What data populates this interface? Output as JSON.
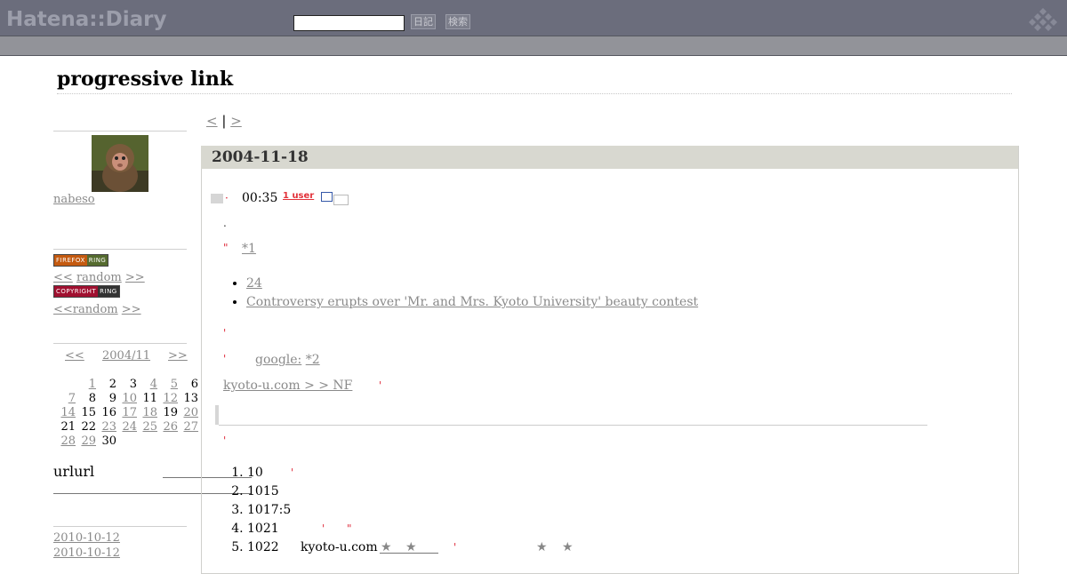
{
  "header": {
    "logo": "Hatena::Diary",
    "search_value": "",
    "diary_button": "日記",
    "search_button": "検索"
  },
  "blog": {
    "title": "progressive link"
  },
  "sidebar": {
    "profile": {
      "username": "nabeso",
      "avatar_icon": "monkey-avatar"
    },
    "rings": [
      {
        "left": "FIREFOX",
        "right": "RING",
        "left_color": "#c45a10",
        "right_color": "#556b2f",
        "nav_prev": "<<",
        "nav_random": "random",
        "nav_next": ">>"
      },
      {
        "left": "COPYRIGHT",
        "right": "RING",
        "left_color": "#a01030",
        "right_color": "#333333",
        "nav_prev": "<<",
        "nav_random": "random",
        "nav_next": ">>"
      }
    ],
    "calendar": {
      "prev": "<<",
      "month": "2004/11",
      "next": ">>",
      "weeks": [
        [
          "",
          "1",
          "2",
          "3",
          "4",
          "5",
          "6"
        ],
        [
          "7",
          "8",
          "9",
          "10",
          "11",
          "12",
          "13"
        ],
        [
          "14",
          "15",
          "16",
          "17",
          "18",
          "19",
          "20"
        ],
        [
          "21",
          "22",
          "23",
          "24",
          "25",
          "26",
          "27"
        ],
        [
          "28",
          "29",
          "30",
          "",
          "",
          "",
          ""
        ]
      ],
      "linked_days": [
        "1",
        "4",
        "5",
        "7",
        "10",
        "12",
        "14",
        "17",
        "18",
        "20",
        "23",
        "24",
        "25",
        "26",
        "27",
        "28",
        "29"
      ],
      "today": "18"
    },
    "section_title": "urlurl",
    "recent": [
      "2010-10-12",
      "2010-10-12"
    ]
  },
  "main": {
    "pager": {
      "prev": "<",
      "sep": "|",
      "next": ">"
    },
    "date": "2004-11-18",
    "entry": {
      "time": "00:35",
      "users_badge": "1 user",
      "footnote1": "*1",
      "bullets": [
        "24",
        "Controversy erupts over 'Mr. and Mrs. Kyoto University' beauty contest"
      ],
      "google_link": "google:",
      "footnote2": "*2",
      "kyoto_link": "kyoto-u.com >  > NF",
      "ordered": [
        "10",
        "1015",
        "1017:5",
        "1021",
        "1022"
      ],
      "kyoto_inline": "kyoto-u.com",
      "star_glyph": "★"
    }
  }
}
